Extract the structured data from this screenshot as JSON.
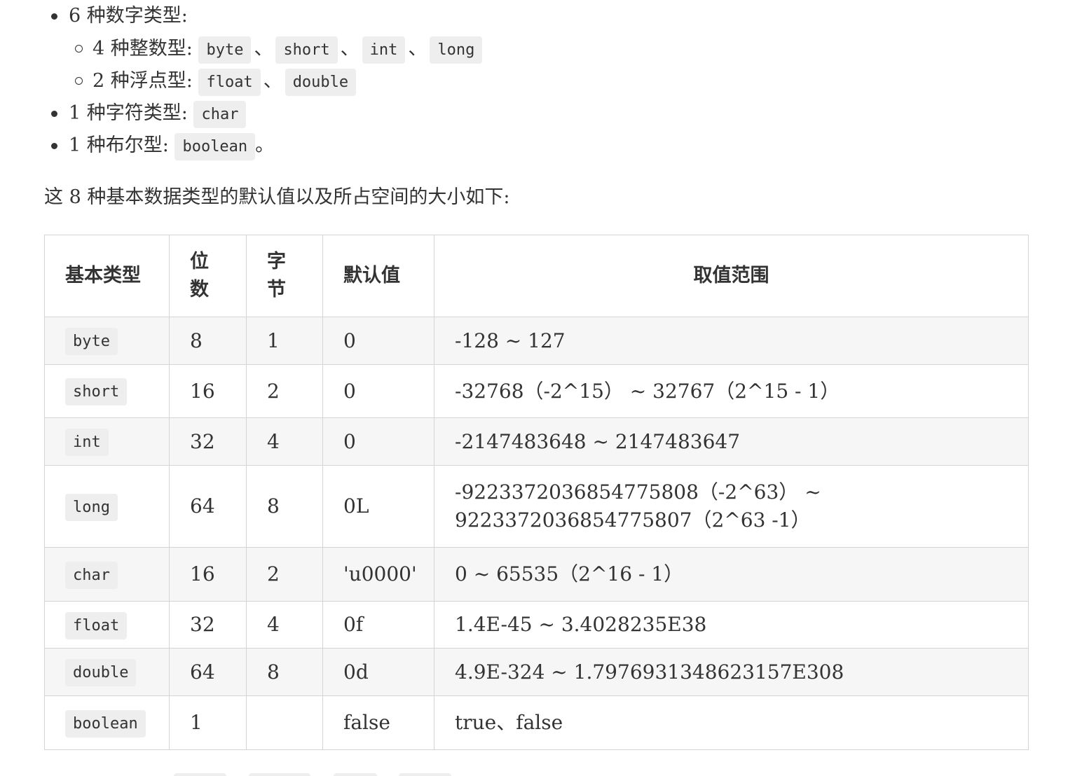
{
  "list": {
    "numeric": {
      "label": "6 种数字类型:",
      "integer": {
        "label": "4 种整数型:",
        "types": [
          "byte",
          "short",
          "int",
          "long"
        ]
      },
      "float": {
        "label": "2 种浮点型:",
        "types": [
          "float",
          "double"
        ]
      }
    },
    "char": {
      "label": "1 种字符类型:",
      "type": "char"
    },
    "bool": {
      "label": "1 种布尔型:",
      "type": "boolean",
      "suffix": "。"
    },
    "separator": "、"
  },
  "intro": "这 8 种基本数据类型的默认值以及所占空间的大小如下:",
  "table": {
    "headers": {
      "type": "基本类型",
      "bits_1": "位",
      "bits_2": "数",
      "bytes_1": "字",
      "bytes_2": "节",
      "default": "默认值",
      "range": "取值范围"
    },
    "rows": [
      {
        "type": "byte",
        "bits": "8",
        "bytes": "1",
        "default": "0",
        "range": "-128 ~ 127"
      },
      {
        "type": "short",
        "bits": "16",
        "bytes": "2",
        "default": "0",
        "range": "-32768（-2^15） ~ 32767（2^15 - 1）"
      },
      {
        "type": "int",
        "bits": "32",
        "bytes": "4",
        "default": "0",
        "range": "-2147483648 ~ 2147483647"
      },
      {
        "type": "long",
        "bits": "64",
        "bytes": "8",
        "default": "0L",
        "range": "-9223372036854775808（-2^63） ~ 9223372036854775807（2^63 -1）"
      },
      {
        "type": "char",
        "bits": "16",
        "bytes": "2",
        "default": "'u0000'",
        "range": "0 ~ 65535（2^16 - 1）"
      },
      {
        "type": "float",
        "bits": "32",
        "bytes": "4",
        "default": "0f",
        "range": "1.4E-45 ~ 3.4028235E38"
      },
      {
        "type": "double",
        "bits": "64",
        "bytes": "8",
        "default": "0d",
        "range": "4.9E-324 ~ 1.7976931348623157E308"
      },
      {
        "type": "boolean",
        "bits": "1",
        "bytes": "",
        "default": "false",
        "range": "true、false"
      }
    ]
  }
}
